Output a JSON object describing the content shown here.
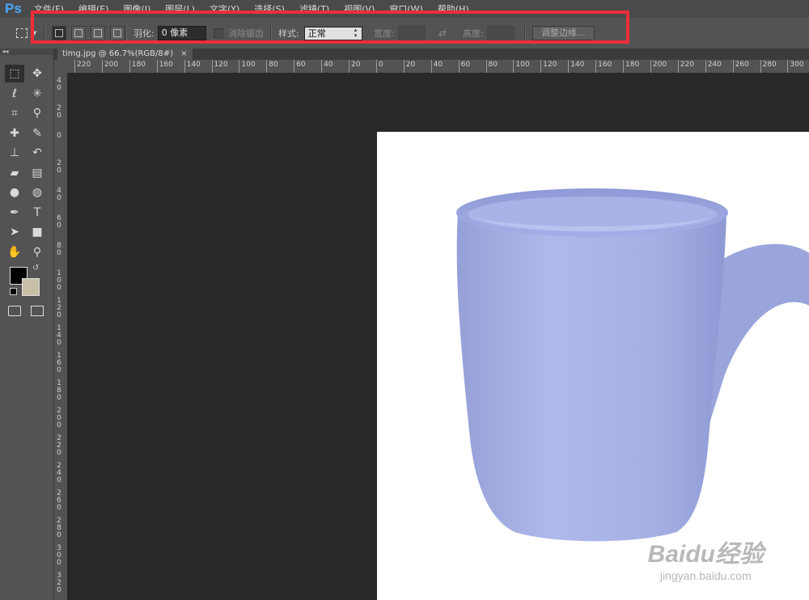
{
  "app": {
    "logo": "Ps"
  },
  "menu": [
    "文件(F)",
    "编辑(E)",
    "图像(I)",
    "图层(L)",
    "文字(Y)",
    "选择(S)",
    "滤镜(T)",
    "视图(V)",
    "窗口(W)",
    "帮助(H)"
  ],
  "options": {
    "feather_label": "羽化:",
    "feather_value": "0 像素",
    "antialias_label": "消除锯齿",
    "style_label": "样式:",
    "style_value": "正常",
    "width_label": "宽度:",
    "height_label": "高度:",
    "refine_edge_label": "调整边缘..."
  },
  "document": {
    "tab_title": "timg.jpg @ 66.7%(RGB/8#)",
    "close": "×"
  },
  "ruler": {
    "h_labels": [
      "220",
      "200",
      "180",
      "160",
      "140",
      "120",
      "100",
      "80",
      "60",
      "40",
      "20",
      "0",
      "20",
      "40",
      "60",
      "80",
      "100",
      "120",
      "140",
      "160",
      "180",
      "200",
      "220",
      "240",
      "260",
      "280",
      "300"
    ],
    "v_labels": [
      "40",
      "20",
      "0",
      "20",
      "40",
      "60",
      "80",
      "100",
      "120",
      "140",
      "160",
      "180",
      "200",
      "220",
      "240",
      "260",
      "280",
      "300",
      "320"
    ]
  },
  "tools": [
    {
      "name": "marquee-tool-icon",
      "glyph": "⬚"
    },
    {
      "name": "move-tool-icon",
      "glyph": "✥"
    },
    {
      "name": "lasso-tool-icon",
      "glyph": "ℓ"
    },
    {
      "name": "magic-wand-tool-icon",
      "glyph": "✳"
    },
    {
      "name": "crop-tool-icon",
      "glyph": "⌗"
    },
    {
      "name": "eyedropper-tool-icon",
      "glyph": "⚲"
    },
    {
      "name": "healing-brush-tool-icon",
      "glyph": "✚"
    },
    {
      "name": "brush-tool-icon",
      "glyph": "✎"
    },
    {
      "name": "clone-stamp-tool-icon",
      "glyph": "⊥"
    },
    {
      "name": "history-brush-tool-icon",
      "glyph": "↶"
    },
    {
      "name": "eraser-tool-icon",
      "glyph": "▰"
    },
    {
      "name": "gradient-tool-icon",
      "glyph": "▤"
    },
    {
      "name": "blur-tool-icon",
      "glyph": "●"
    },
    {
      "name": "dodge-tool-icon",
      "glyph": "◍"
    },
    {
      "name": "pen-tool-icon",
      "glyph": "✒"
    },
    {
      "name": "type-tool-icon",
      "glyph": "T"
    },
    {
      "name": "path-selection-tool-icon",
      "glyph": "➤"
    },
    {
      "name": "rectangle-tool-icon",
      "glyph": "■"
    },
    {
      "name": "hand-tool-icon",
      "glyph": "✋"
    },
    {
      "name": "zoom-tool-icon",
      "glyph": "⚲"
    }
  ],
  "colors": {
    "foreground": "#000000",
    "background": "#c8c0a6",
    "mug": "#a7b1e3",
    "highlight_box": "#ee2d3a"
  },
  "watermark": {
    "main": "Baidu经验",
    "sub": "jingyan.baidu.com"
  }
}
